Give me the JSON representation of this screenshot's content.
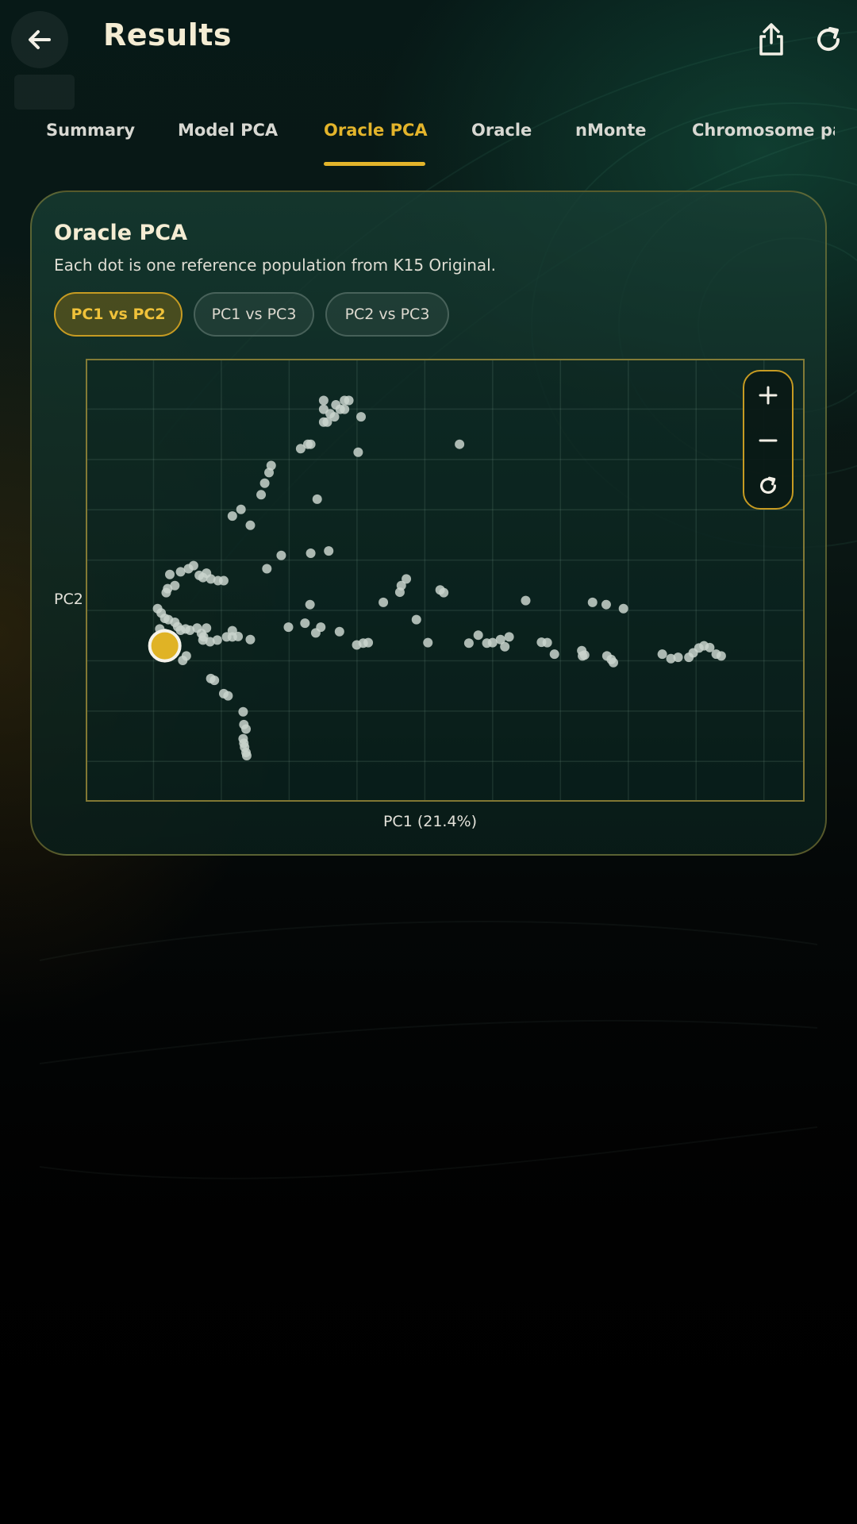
{
  "header": {
    "title": "Results",
    "back_icon": "arrow-left-icon",
    "share_icon": "share-icon",
    "refresh_icon": "refresh-icon"
  },
  "tabs": [
    {
      "label": "Summary",
      "active": false
    },
    {
      "label": "Model PCA",
      "active": false
    },
    {
      "label": "Oracle PCA",
      "active": true
    },
    {
      "label": "Oracle",
      "active": false
    },
    {
      "label": "nMonte",
      "active": false
    },
    {
      "label": "Chromosome painting",
      "active": false
    }
  ],
  "card": {
    "title": "Oracle PCA",
    "subtitle": "Each dot is one reference population from K15 Original.",
    "chips": [
      {
        "label": "PC1 vs PC2",
        "active": true
      },
      {
        "label": "PC1 vs PC3",
        "active": false
      },
      {
        "label": "PC2 vs PC3",
        "active": false
      }
    ],
    "zoom_controls": {
      "zoom_in_icon": "plus-icon",
      "zoom_out_icon": "minus-icon",
      "reset_icon": "refresh-icon"
    }
  },
  "colors": {
    "accent": "#e3b42b",
    "reference_dot": "#c9d4cd",
    "user_dot": "#e0b325",
    "title_text": "#f4ecd3"
  },
  "chart_data": {
    "type": "scatter",
    "title": "",
    "xlabel": "PC1 (21.4%)",
    "ylabel": "PC2",
    "xlim": [
      0,
      100
    ],
    "ylim": [
      0,
      100
    ],
    "grid": true,
    "legend": "none",
    "series": [
      {
        "role": "reference",
        "points": [
          [
            33.1,
            90.6
          ],
          [
            36.6,
            90.6
          ],
          [
            36.0,
            90.6
          ],
          [
            34.8,
            89.6
          ],
          [
            33.1,
            88.6
          ],
          [
            35.4,
            88.6
          ],
          [
            36.0,
            88.6
          ],
          [
            34.0,
            87.6
          ],
          [
            34.6,
            86.9
          ],
          [
            38.3,
            86.9
          ],
          [
            33.1,
            85.7
          ],
          [
            33.6,
            85.7
          ],
          [
            30.9,
            80.7
          ],
          [
            29.9,
            79.7
          ],
          [
            31.3,
            80.7
          ],
          [
            52.0,
            80.7
          ],
          [
            37.9,
            78.9
          ],
          [
            25.8,
            75.9
          ],
          [
            25.5,
            74.3
          ],
          [
            24.9,
            71.9
          ],
          [
            24.4,
            69.3
          ],
          [
            32.2,
            68.3
          ],
          [
            21.6,
            66.0
          ],
          [
            20.4,
            64.5
          ],
          [
            22.9,
            62.4
          ],
          [
            31.3,
            56.1
          ],
          [
            33.8,
            56.6
          ],
          [
            27.2,
            55.6
          ],
          [
            25.2,
            52.6
          ],
          [
            13.2,
            51.9
          ],
          [
            14.3,
            52.6
          ],
          [
            15.0,
            53.3
          ],
          [
            11.7,
            51.3
          ],
          [
            16.8,
            51.6
          ],
          [
            15.8,
            51.1
          ],
          [
            16.3,
            50.6
          ],
          [
            17.4,
            50.3
          ],
          [
            18.4,
            49.9
          ],
          [
            19.2,
            49.9
          ],
          [
            12.4,
            48.8
          ],
          [
            11.2,
            47.2
          ],
          [
            11.4,
            48.1
          ],
          [
            43.9,
            48.8
          ],
          [
            44.6,
            50.3
          ],
          [
            49.3,
            47.8
          ],
          [
            49.8,
            47.2
          ],
          [
            43.7,
            47.3
          ],
          [
            61.2,
            45.4
          ],
          [
            31.2,
            44.5
          ],
          [
            41.4,
            45.0
          ],
          [
            70.5,
            45.0
          ],
          [
            72.4,
            44.5
          ],
          [
            74.8,
            43.6
          ],
          [
            46.0,
            41.1
          ],
          [
            10.0,
            43.6
          ],
          [
            10.5,
            42.6
          ],
          [
            11.0,
            41.4
          ],
          [
            11.5,
            41.1
          ],
          [
            12.4,
            40.5
          ],
          [
            12.8,
            39.5
          ],
          [
            13.2,
            38.7
          ],
          [
            13.9,
            39.0
          ],
          [
            14.5,
            38.7
          ],
          [
            10.3,
            39.0
          ],
          [
            11.0,
            38.0
          ],
          [
            15.5,
            39.2
          ],
          [
            16.1,
            38.0
          ],
          [
            16.4,
            37.2
          ],
          [
            16.8,
            39.2
          ],
          [
            16.3,
            36.5
          ],
          [
            17.3,
            36.1
          ],
          [
            18.3,
            36.5
          ],
          [
            19.6,
            37.2
          ],
          [
            20.4,
            37.2
          ],
          [
            20.4,
            38.6
          ],
          [
            21.2,
            37.3
          ],
          [
            22.9,
            36.6
          ],
          [
            28.2,
            39.4
          ],
          [
            30.5,
            40.3
          ],
          [
            32.7,
            39.4
          ],
          [
            32.0,
            38.1
          ],
          [
            35.3,
            38.4
          ],
          [
            37.7,
            35.4
          ],
          [
            38.6,
            35.8
          ],
          [
            39.3,
            35.9
          ],
          [
            47.6,
            35.9
          ],
          [
            53.3,
            35.8
          ],
          [
            54.6,
            37.6
          ],
          [
            55.8,
            35.8
          ],
          [
            56.6,
            35.9
          ],
          [
            57.7,
            36.6
          ],
          [
            58.3,
            35.0
          ],
          [
            58.9,
            37.2
          ],
          [
            63.4,
            36.0
          ],
          [
            64.2,
            35.9
          ],
          [
            65.2,
            33.3
          ],
          [
            69.0,
            34.1
          ],
          [
            69.1,
            32.9
          ],
          [
            69.4,
            33.1
          ],
          [
            72.5,
            32.9
          ],
          [
            73.1,
            32.1
          ],
          [
            73.4,
            31.4
          ],
          [
            80.2,
            33.3
          ],
          [
            81.4,
            32.3
          ],
          [
            82.4,
            32.6
          ],
          [
            83.9,
            32.6
          ],
          [
            84.5,
            33.6
          ],
          [
            85.3,
            34.7
          ],
          [
            86.0,
            35.2
          ],
          [
            86.8,
            34.8
          ],
          [
            87.7,
            33.3
          ],
          [
            88.4,
            32.9
          ],
          [
            14.0,
            32.9
          ],
          [
            13.5,
            31.9
          ],
          [
            17.4,
            27.8
          ],
          [
            17.9,
            27.4
          ],
          [
            19.2,
            24.4
          ],
          [
            19.8,
            23.9
          ],
          [
            21.9,
            20.3
          ],
          [
            22.0,
            17.4
          ],
          [
            22.3,
            16.4
          ],
          [
            21.9,
            14.2
          ],
          [
            22.0,
            13.2
          ],
          [
            22.1,
            12.3
          ],
          [
            22.3,
            11.1
          ],
          [
            22.4,
            10.4
          ]
        ]
      },
      {
        "role": "user",
        "points": [
          [
            11.0,
            35.2
          ]
        ]
      }
    ]
  }
}
